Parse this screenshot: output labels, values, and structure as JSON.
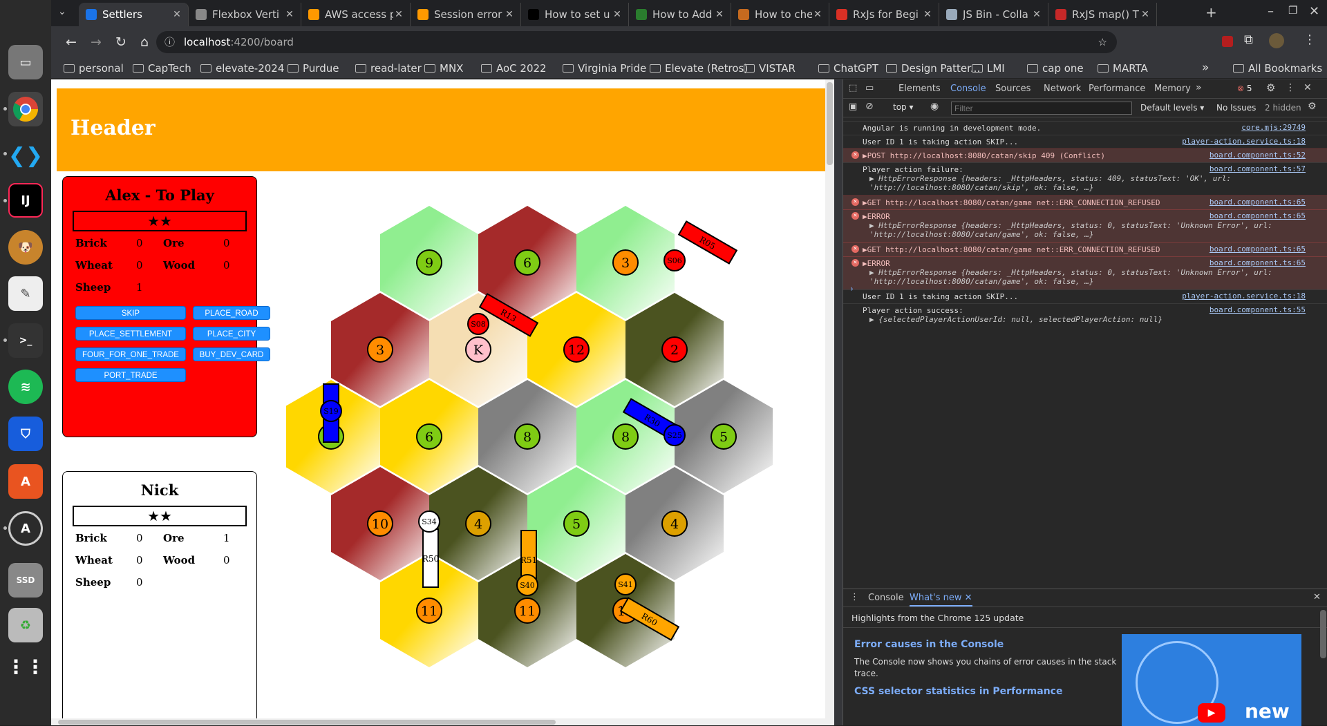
{
  "tabs": [
    {
      "label": "Settlers",
      "color": "#1a73e8",
      "active": true
    },
    {
      "label": "Flexbox Verti",
      "color": "#888888"
    },
    {
      "label": "AWS access p",
      "color": "#ff9900"
    },
    {
      "label": "Session error",
      "color": "#ff9900"
    },
    {
      "label": "How to set u",
      "color": "#000000"
    },
    {
      "label": "How to Add R",
      "color": "#2a7d2e"
    },
    {
      "label": "How to check",
      "color": "#c56a1f"
    },
    {
      "label": "RxJs for Begi",
      "color": "#d93025"
    },
    {
      "label": "JS Bin - Colla",
      "color": "#9ab"
    },
    {
      "label": "RxJS map() T",
      "color": "#c62828"
    }
  ],
  "url": {
    "host": "localhost",
    "rest": ":4200/board"
  },
  "bookmarks": [
    "personal",
    "CapTech",
    "elevate-2024",
    "Purdue",
    "read-later",
    "MNX",
    "AoC 2022",
    "Virginia Pride",
    "Elevate (Retros)",
    "VISTAR",
    "ChatGPT",
    "Design Patter...",
    "LMI",
    "cap one",
    "MARTA"
  ],
  "all_bookmarks": "All Bookmarks",
  "page": {
    "header": "Header",
    "players": [
      {
        "name": "Alex - To Play",
        "stars": "★★",
        "color": "#ff0000",
        "resources": {
          "brick": "0",
          "ore": "0",
          "wheat": "0",
          "wood": "0",
          "sheep": "1"
        },
        "actions": [
          "SKIP",
          "PLACE_ROAD",
          "PLACE_SETTLEMENT",
          "PLACE_CITY",
          "FOUR_FOR_ONE_TRADE",
          "BUY_DEV_CARD",
          "PORT_TRADE"
        ]
      },
      {
        "name": "Nick",
        "stars": "★★",
        "color": "#ffffff",
        "resources": {
          "brick": "0",
          "ore": "1",
          "wheat": "0",
          "wood": "0",
          "sheep": "0"
        }
      }
    ],
    "resource_labels": {
      "brick": "Brick",
      "ore": "Ore",
      "wheat": "Wheat",
      "wood": "Wood",
      "sheep": "Sheep"
    },
    "hexes": [
      {
        "type": "sheep",
        "token": "9"
      },
      {
        "type": "brick",
        "token": "6"
      },
      {
        "type": "sheep",
        "token": "3"
      },
      {
        "type": "brick",
        "token": "3"
      },
      {
        "type": "desert",
        "token": "K"
      },
      {
        "type": "wheat",
        "token": "12"
      },
      {
        "type": "wood",
        "token": "2"
      },
      {
        "type": "wheat",
        "token": "9"
      },
      {
        "type": "wheat",
        "token": "6"
      },
      {
        "type": "ore",
        "token": "8"
      },
      {
        "type": "sheep",
        "token": "8"
      },
      {
        "type": "ore",
        "token": "5"
      },
      {
        "type": "brick",
        "token": "10"
      },
      {
        "type": "wood",
        "token": "4"
      },
      {
        "type": "sheep",
        "token": "5"
      },
      {
        "type": "ore",
        "token": "4"
      },
      {
        "type": "wheat",
        "token": "11"
      },
      {
        "type": "wood",
        "token": "11"
      },
      {
        "type": "wood",
        "token": "10"
      }
    ],
    "pieces": {
      "roads": [
        "R05",
        "R13",
        "R19",
        "R30",
        "R50",
        "R51",
        "R60"
      ],
      "settlements": [
        "S06",
        "S08",
        "S19",
        "S25",
        "S34",
        "S40",
        "S41"
      ]
    },
    "colors": {
      "red": "#ff0000",
      "blue": "#0000ff",
      "white": "#ffffff",
      "orange": "#ffa500"
    }
  },
  "devtools": {
    "tabs": [
      "Elements",
      "Console",
      "Sources",
      "Network",
      "Performance",
      "Memory"
    ],
    "active_tab": "Console",
    "error_count": "5",
    "context": "top",
    "filter_placeholder": "Filter",
    "levels": "Default levels",
    "issues": "No Issues",
    "hidden": "2 hidden",
    "logs": [
      {
        "level": "info",
        "text": "Angular is running in development mode.",
        "src": "core.mjs:29749"
      },
      {
        "level": "info",
        "text": "User ID 1 is taking action SKIP...",
        "src": "player-action.service.ts:18"
      },
      {
        "level": "error",
        "text": "▶POST http://localhost:8080/catan/skip 409 (Conflict)",
        "src": "board.component.ts:52"
      },
      {
        "level": "info",
        "text": "Player action failure:",
        "detail": "▶ HttpErrorResponse {headers: _HttpHeaders, status: 409, statusText: 'OK', url: 'http://localhost:8080/catan/skip', ok: false, …}",
        "src": "board.component.ts:57"
      },
      {
        "level": "error",
        "text": "▶GET http://localhost:8080/catan/game net::ERR_CONNECTION_REFUSED",
        "src": "board.component.ts:65"
      },
      {
        "level": "error",
        "text": "▶ERROR",
        "detail": "▶ HttpErrorResponse {headers: _HttpHeaders, status: 0, statusText: 'Unknown Error', url: 'http://localhost:8080/catan/game', ok: false, …}",
        "src": "board.component.ts:65"
      },
      {
        "level": "error",
        "text": "▶GET http://localhost:8080/catan/game net::ERR_CONNECTION_REFUSED",
        "src": "board.component.ts:65"
      },
      {
        "level": "error",
        "text": "▶ERROR",
        "detail": "▶ HttpErrorResponse {headers: _HttpHeaders, status: 0, statusText: 'Unknown Error', url: 'http://localhost:8080/catan/game', ok: false, …}",
        "src": "board.component.ts:65"
      },
      {
        "level": "info",
        "text": "User ID 1 is taking action SKIP...",
        "src": "player-action.service.ts:18"
      },
      {
        "level": "info",
        "text": "Player action success:",
        "detail": "▶ {selectedPlayerActionUserId: null, selectedPlayerAction: null}",
        "src": "board.component.ts:55"
      }
    ],
    "drawer": {
      "tabs": [
        "Console",
        "What's new"
      ],
      "highlights": "Highlights from the Chrome 125 update",
      "items": [
        {
          "title": "Error causes in the Console",
          "body": "The Console now shows you chains of error causes in the stack trace."
        },
        {
          "title": "CSS selector statistics in Performance",
          "body": ""
        }
      ],
      "video_label": "new"
    }
  }
}
